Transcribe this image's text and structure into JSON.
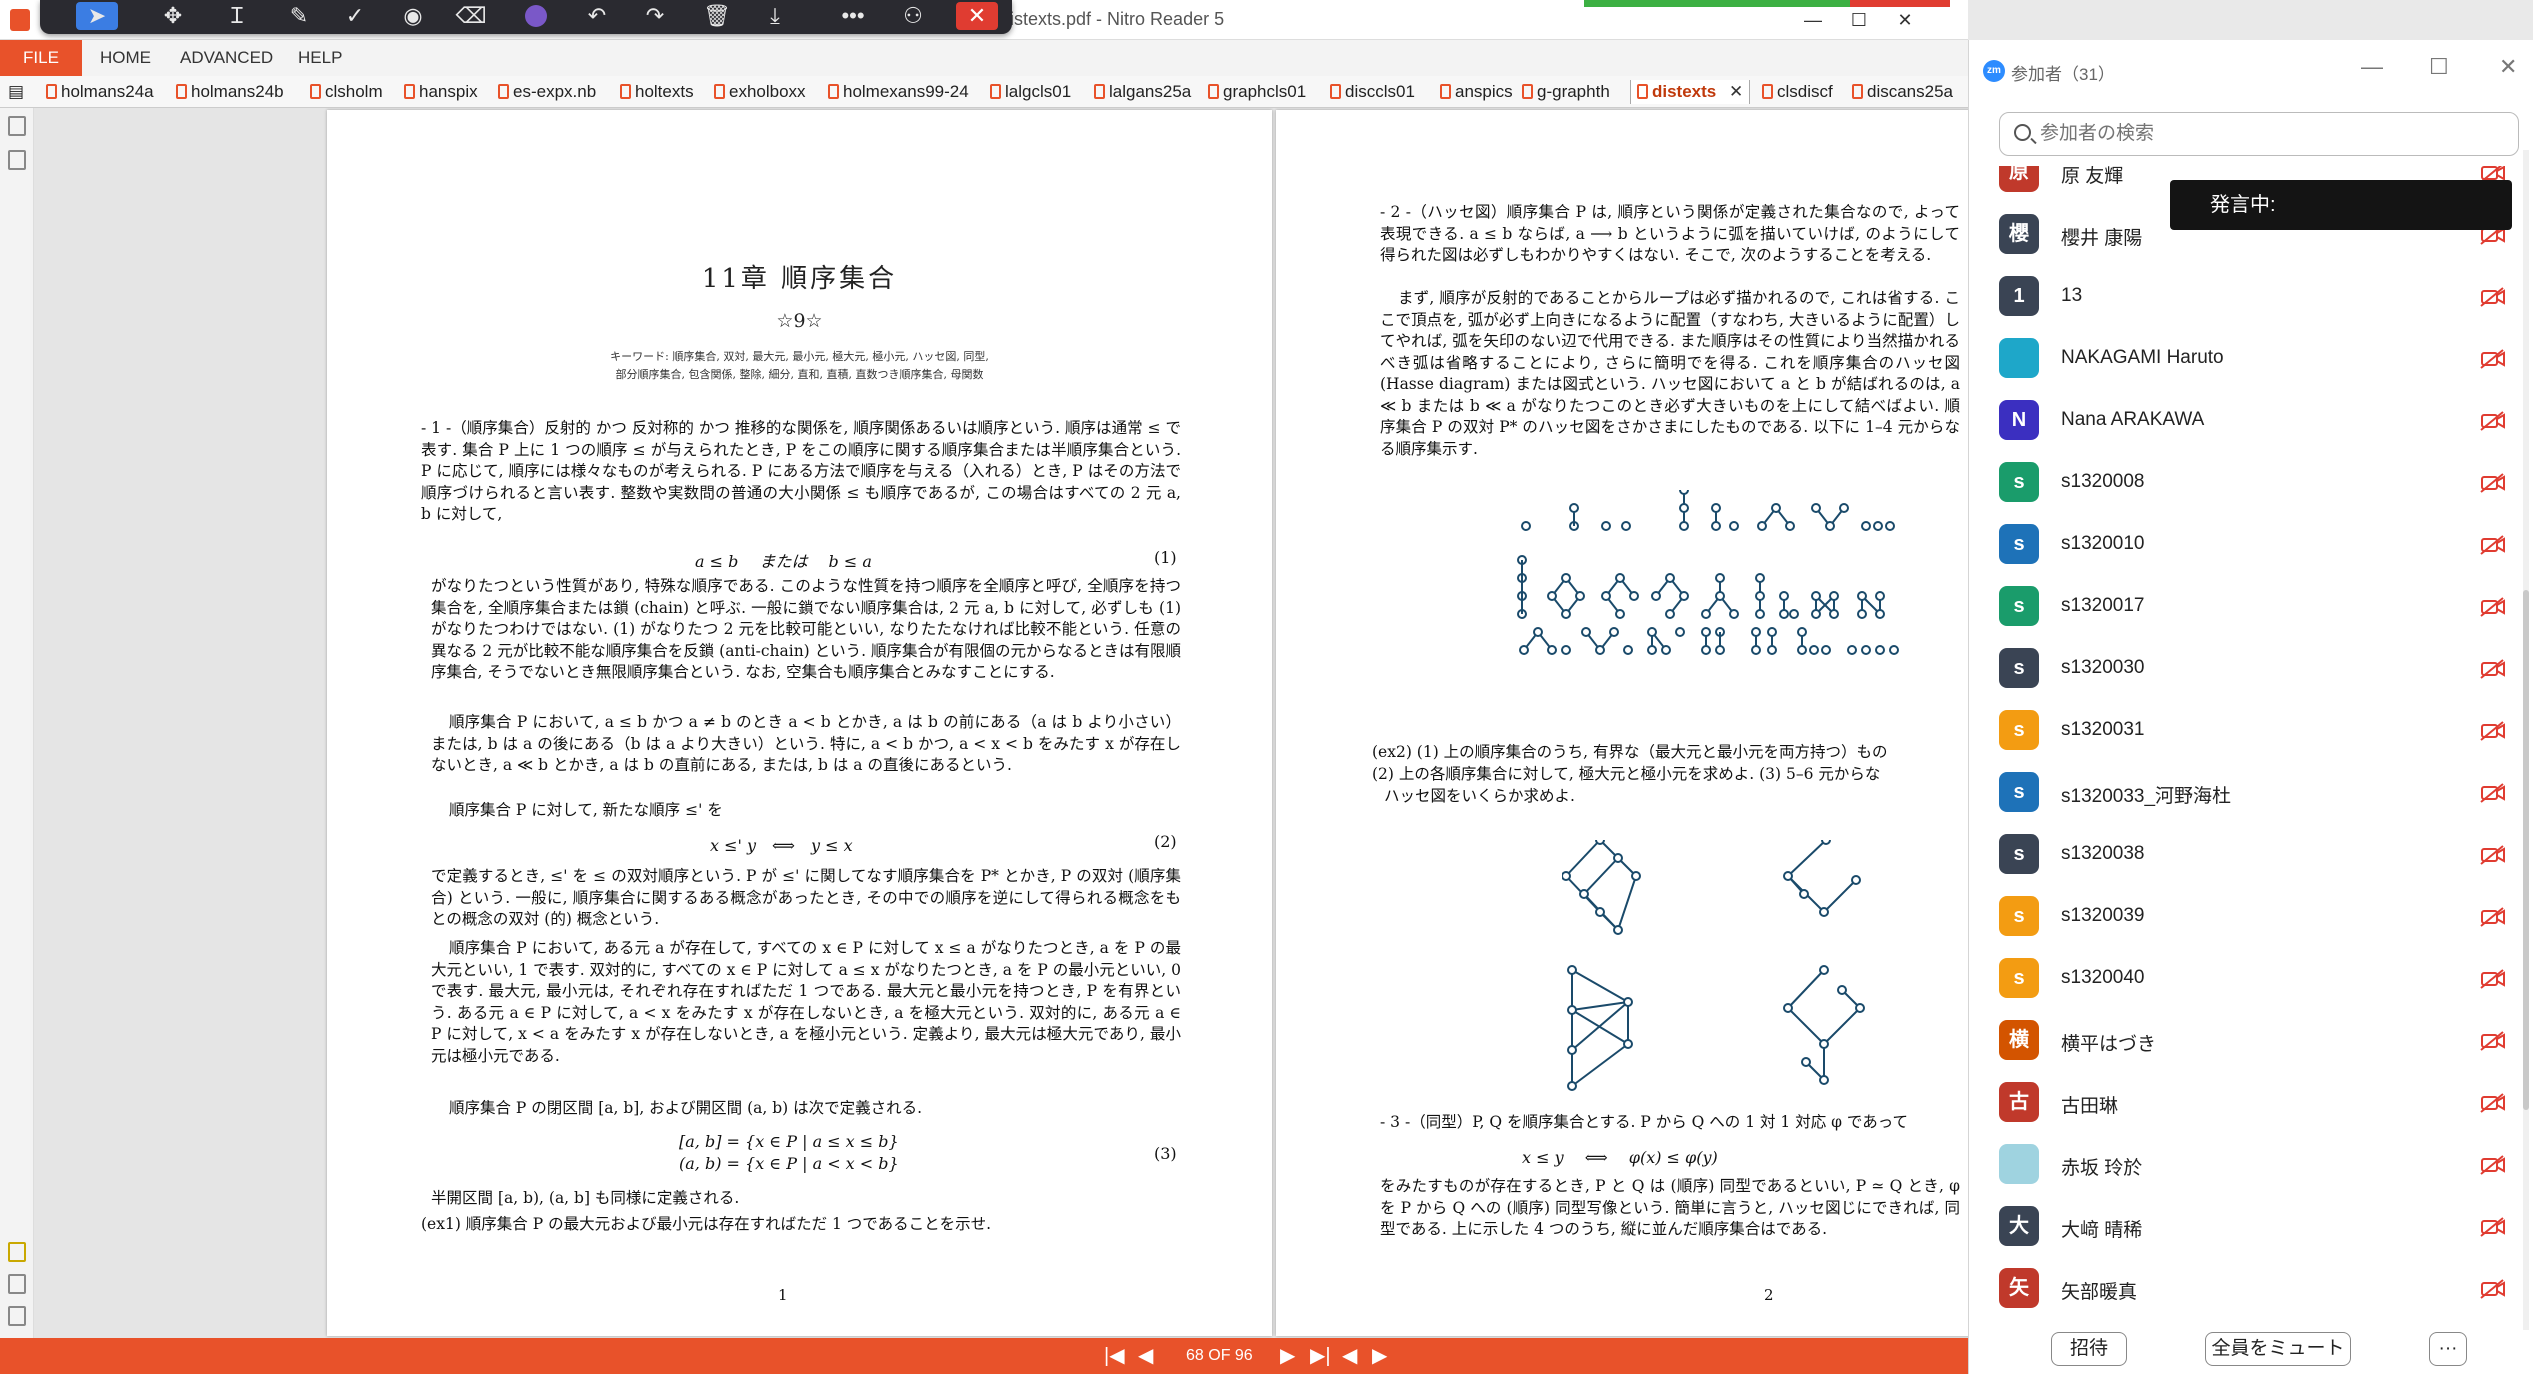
{
  "window": {
    "title": "distexts.pdf - Nitro Reader 5",
    "minimize_icon": "—",
    "maximize_icon": "☐",
    "close_icon": "✕"
  },
  "annotation_toolbar": {
    "tools": [
      "pointer",
      "move",
      "text-cursor",
      "pen",
      "check",
      "stamp",
      "eraser",
      "color",
      "undo",
      "redo",
      "delete",
      "save",
      "more",
      "participants",
      "close"
    ]
  },
  "menu": {
    "file": "FILE",
    "items": [
      "HOME",
      "ADVANCED",
      "HELP"
    ]
  },
  "tabs": [
    "holmans24a",
    "holmans24b",
    "clsholm",
    "hanspix",
    "es-expx.nb",
    "holtexts",
    "exholboxx",
    "holmexans99-24",
    "lalgcls01",
    "lalgans25a",
    "graphcls01",
    "disccls01",
    "anspics",
    "g-graphth",
    "distexts",
    "clsdiscf",
    "discans25a"
  ],
  "active_tab": "distexts",
  "active_tab_close": "✕",
  "page1": {
    "chapter_title": "11章 順序集合",
    "stars": "☆9☆",
    "keywords_line1": "キーワード: 順序集合, 双対, 最大元, 最小元, 極大元, 極小元, ハッセ図, 同型,",
    "keywords_line2": "部分順序集合, 包含関係, 整除, 細分, 直和, 直積, 直数つき順序集合, 母関数",
    "para1": "- 1 -（順序集合）反射的 かつ 反対称的 かつ 推移的な関係を, 順序関係あるいは順序という. 順序は通常 ≤ で表す. 集合 P 上に 1 つの順序 ≤ が与えられたとき, P をこの順序に関する順序集合または半順序集合という. P に応じて, 順序には様々なものが考えられる. P にある方法で順序を与える（入れる）とき, P はその方法で順序づけられると言い表す. 整数や実数問の普通の大小関係 ≤ も順序であるが, この場合はすべての 2 元 a, b に対して,",
    "eq1": "a ≤ b　 または　 b ≤ a",
    "eq1_no": "(1)",
    "para2": "がなりたつという性質があり, 特殊な順序である. このような性質を持つ順序を全順序と呼び, 全順序を持つ集合を, 全順序集合または鎖 (chain) と呼ぶ. 一般に鎖でない順序集合は, 2 元 a, b に対して, 必ずしも (1) がなりたつわけではない. (1) がなりたつ 2 元を比較可能といい, なりたたなければ比較不能という. 任意の異なる 2 元が比較不能な順序集合を反鎖 (anti-chain) という. 順序集合が有限個の元からなるときは有限順序集合, そうでないとき無限順序集合という. なお, 空集合も順序集合とみなすことにする.",
    "para3": "順序集合 P において, a ≤ b かつ a ≠ b のとき a < b とかき, a は b の前にある（a は b より小さい）または, b は a の後にある（b は a より大きい）という. 特に, a < b かつ, a < x < b をみたす x が存在しないとき, a ≪ b とかき, a は b の直前にある, または, b は a の直後にあるという.",
    "para4": "順序集合 P に対して, 新たな順序 ≤' を",
    "eq2": "x ≤' y　⟺　y ≤ x",
    "eq2_no": "(2)",
    "para5": "で定義するとき, ≤' を ≤ の双対順序という. P が ≤' に関してなす順序集合を P* とかき, P の双対 (順序集合) という. 一般に, 順序集合に関するある概念があったとき, その中での順序を逆にして得られる概念をもとの概念の双対 (的) 概念という.",
    "para6": "順序集合 P において, ある元 a が存在して, すべての x ∈ P に対して x ≤ a がなりたつとき, a を P の最大元といい, 1 で表す. 双対的に, すべての x ∈ P に対して a ≤ x がなりたつとき, a を P の最小元といい, 0 で表す. 最大元, 最小元は, それぞれ存在すればただ 1 つである. 最大元と最小元を持つとき, P を有界という. ある元 a ∈ P に対して, a < x をみたす x が存在しないとき, a を極大元という. 双対的に, ある元 a ∈ P に対して, x < a をみたす x が存在しないとき, a を極小元という. 定義より, 最大元は極大元であり, 最小元は極小元である.",
    "para7": "順序集合 P の閉区間 [a, b], および開区間 (a, b) は次で定義される.",
    "eq3a": "[a, b] = {x ∈ P | a ≤ x ≤ b}",
    "eq3b": "(a, b) = {x ∈ P | a < x < b}",
    "eq3_no": "(3)",
    "para8": "半開区間 [a, b), (a, b] も同様に定義される.",
    "para9": "(ex1) 順序集合 P の最大元および最小元は存在すればただ 1 つであることを示せ.",
    "page_number": "1"
  },
  "page2": {
    "para1": "- 2 -（ハッセ図）順序集合 P は, 順序という関係が定義された集合なので, よって表現できる. a ≤ b ならば, a ⟶ b というように弧を描いていけば, のようにして得られた図は必ずしもわかりやすくはない. そこで, 次のようすることを考える.",
    "para2": "まず, 順序が反射的であることからループは必ず描かれるので, これは省する. ここで頂点を, 弧が必ず上向きになるように配置（すなわち, 大きいるように配置）してやれば, 弧を矢印のない辺で代用できる. また順序はその性質により当然描かれるべき弧は省略することにより, さらに簡明でを得る. これを順序集合のハッセ図 (Hasse diagram) または図式という. ハッセ図において a と b が結ばれるのは, a ≪ b または b ≪ a がなりたつこのとき必ず大きいものを上にして結べばよい. 順序集合 P の双対 P* のハッセ図をさかさまにしたものである. 以下に 1–4 元からなる順序集示す.",
    "ex2_line1": "(ex2) (1) 上の順序集合のうち, 有界な（最大元と最小元を両方持つ）もの",
    "ex2_line2": "(2) 上の各順序集合に対して, 極大元と極小元を求めよ. (3) 5–6 元からな",
    "ex2_line3": "ハッセ図をいくらか求めよ.",
    "para3": "- 3 -（同型）P, Q を順序集合とする. P から Q への 1 対 1 対応 φ であって",
    "eq": "x ≤ y　 ⟺　 φ(x) ≤ φ(y)",
    "para4": "をみたすものが存在するとき, P と Q は (順序) 同型であるといい, P ≃ Q とき, φ を P から Q への (順序) 同型写像という. 簡単に言うと, ハッセ図じにできれば, 同型である. 上に示した 4 つのうち, 縦に並んだ順序集合はである.",
    "page_number": "2"
  },
  "statusbar": {
    "page_indicator": "68 OF 96",
    "first": "|◀",
    "prev": "◀",
    "next": "▶",
    "last": "▶|"
  },
  "zoom": {
    "title": "参加者（31）",
    "logo": "zm",
    "search_placeholder": "参加者の検索",
    "speaking_label": "発言中:",
    "participants": [
      {
        "name": "原 友輝",
        "avatar": "原",
        "color": "#c0392b"
      },
      {
        "name": "櫻井 康陽",
        "avatar": "櫻",
        "color": "#3a4454"
      },
      {
        "name": "13",
        "avatar": "1",
        "color": "#3a4454"
      },
      {
        "name": "NAKAGAMI Haruto",
        "avatar": "",
        "color": "#1ea7c9"
      },
      {
        "name": "Nana ARAKAWA",
        "avatar": "N",
        "color": "#3b2fc0"
      },
      {
        "name": "s1320008",
        "avatar": "s",
        "color": "#1a9c6b"
      },
      {
        "name": "s1320010",
        "avatar": "s",
        "color": "#1e72b8"
      },
      {
        "name": "s1320017",
        "avatar": "s",
        "color": "#1a9c6b"
      },
      {
        "name": "s1320030",
        "avatar": "s",
        "color": "#3a4454"
      },
      {
        "name": "s1320031",
        "avatar": "s",
        "color": "#f39c12"
      },
      {
        "name": "s1320033_河野海杜",
        "avatar": "s",
        "color": "#1e72b8"
      },
      {
        "name": "s1320038",
        "avatar": "s",
        "color": "#3a4454"
      },
      {
        "name": "s1320039",
        "avatar": "s",
        "color": "#f39c12"
      },
      {
        "name": "s1320040",
        "avatar": "s",
        "color": "#f39c12"
      },
      {
        "name": "横平はづき",
        "avatar": "横",
        "color": "#d35400"
      },
      {
        "name": "古田琳",
        "avatar": "古",
        "color": "#c0392b"
      },
      {
        "name": "赤坂 玲於",
        "avatar": "",
        "color": "#9fd3e0"
      },
      {
        "name": "大﨑 晴稀",
        "avatar": "大",
        "color": "#3a4454"
      },
      {
        "name": "矢部暖真",
        "avatar": "矢",
        "color": "#c0392b"
      }
    ],
    "invite_label": "招待",
    "mute_all_label": "全員をミュート",
    "more_label": "···"
  }
}
